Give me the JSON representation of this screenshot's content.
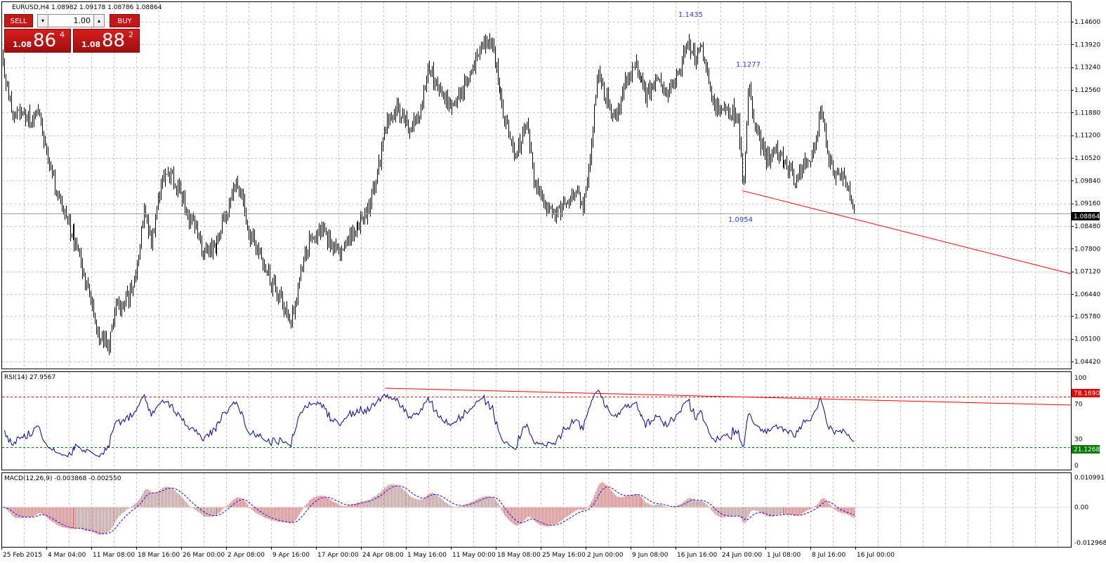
{
  "chart_title": "EURUSD,H4  1.08982 1.09178 1.08786 1.08864",
  "trade_panel": {
    "sell_label": "SELL",
    "buy_label": "BUY",
    "lot": "1.00",
    "sell_price_prefix": "1.08",
    "sell_price_big": "86",
    "sell_price_sup": "4",
    "buy_price_prefix": "1.08",
    "buy_price_big": "88",
    "buy_price_sup": "2",
    "down_icon": "triangle-down",
    "up_icon": "triangle-up"
  },
  "colors": {
    "candles": "#000000",
    "grid": "#c8c8c8",
    "trendline": "#ff0000",
    "rsi": "#0000aa",
    "macd_hist": "#ff6b6b",
    "macd_signal": "#0000ff",
    "annotation": "#2f3fd6",
    "level_high": "#ff0000",
    "level_low": "#008000",
    "sell_buy_red": "#c41717"
  },
  "annotations": [
    {
      "label": "1.1435",
      "price": 1.1435,
      "date": "16 Jun 16:00"
    },
    {
      "label": "1.1277",
      "price": 1.1277,
      "date": "24 Jun 00:00"
    },
    {
      "label": "1.0954",
      "price": 1.0954,
      "date": "24 Jun 00:00"
    }
  ],
  "price_axis": {
    "labels": [
      "1.14600",
      "1.13920",
      "1.13240",
      "1.12560",
      "1.11880",
      "1.11200",
      "1.10520",
      "1.09840",
      "1.09160",
      "1.08480",
      "1.07800",
      "1.07120",
      "1.06440",
      "1.05780",
      "1.05100",
      "1.04420"
    ],
    "current_price": "1.08864",
    "min": 1.0442,
    "max": 1.146
  },
  "time_axis": {
    "labels": [
      "25 Feb 2015",
      "4 Mar 04:00",
      "11 Mar 08:00",
      "18 Mar 16:00",
      "26 Mar 00:00",
      "2 Apr 08:00",
      "9 Apr 16:00",
      "17 Apr 00:00",
      "24 Apr 08:00",
      "1 May 16:00",
      "11 May 00:00",
      "18 May 08:00",
      "25 May 16:00",
      "2 Jun 00:00",
      "9 Jun 08:00",
      "16 Jun 16:00",
      "24 Jun 00:00",
      "1 Jul 08:00",
      "8 Jul 16:00",
      "16 Jul 00:00"
    ]
  },
  "rsi": {
    "label": "RSI(14) 27.9567",
    "axis_labels": [
      "100",
      "70",
      "30",
      "0"
    ],
    "overbought": "78.1690",
    "oversold": "21.1268",
    "value": 27.9567
  },
  "macd": {
    "label": "MACD(12,26,9) -0.003868 -0.002550",
    "axis_labels": [
      "0.010991",
      "0.00",
      "-0.012968"
    ],
    "main": -0.003868,
    "signal": -0.00255
  },
  "chart_data": {
    "type": "candlestick",
    "symbol": "EURUSD",
    "timeframe": "H4",
    "last_ohlc": {
      "open": 1.08982,
      "high": 1.09178,
      "low": 1.08786,
      "close": 1.08864
    },
    "ylim": [
      1.0442,
      1.146
    ],
    "key_closes": [
      {
        "x": "25 Feb 2015",
        "y": 1.137
      },
      {
        "x": "4 Mar 04:00",
        "y": 1.1035
      },
      {
        "x": "11 Mar 08:00",
        "y": 1.0525
      },
      {
        "x": "18 Mar 16:00",
        "y": 1.088
      },
      {
        "x": "26 Mar 00:00",
        "y": 1.094
      },
      {
        "x": "2 Apr 08:00",
        "y": 1.1
      },
      {
        "x": "9 Apr 16:00",
        "y": 1.056
      },
      {
        "x": "17 Apr 00:00",
        "y": 1.08
      },
      {
        "x": "24 Apr 08:00",
        "y": 1.087
      },
      {
        "x": "1 May 16:00",
        "y": 1.12
      },
      {
        "x": "11 May 00:00",
        "y": 1.13
      },
      {
        "x": "18 May 08:00",
        "y": 1.115
      },
      {
        "x": "25 May 16:00",
        "y": 1.087
      },
      {
        "x": "2 Jun 00:00",
        "y": 1.12
      },
      {
        "x": "9 Jun 08:00",
        "y": 1.13
      },
      {
        "x": "16 Jun 16:00",
        "y": 1.14
      },
      {
        "x": "24 Jun 00:00",
        "y": 1.112
      },
      {
        "x": "1 Jul 08:00",
        "y": 1.107
      },
      {
        "x": "8 Jul 16:00",
        "y": 1.117
      },
      {
        "x": "16 Jul 00:00",
        "y": 1.0886
      }
    ]
  }
}
